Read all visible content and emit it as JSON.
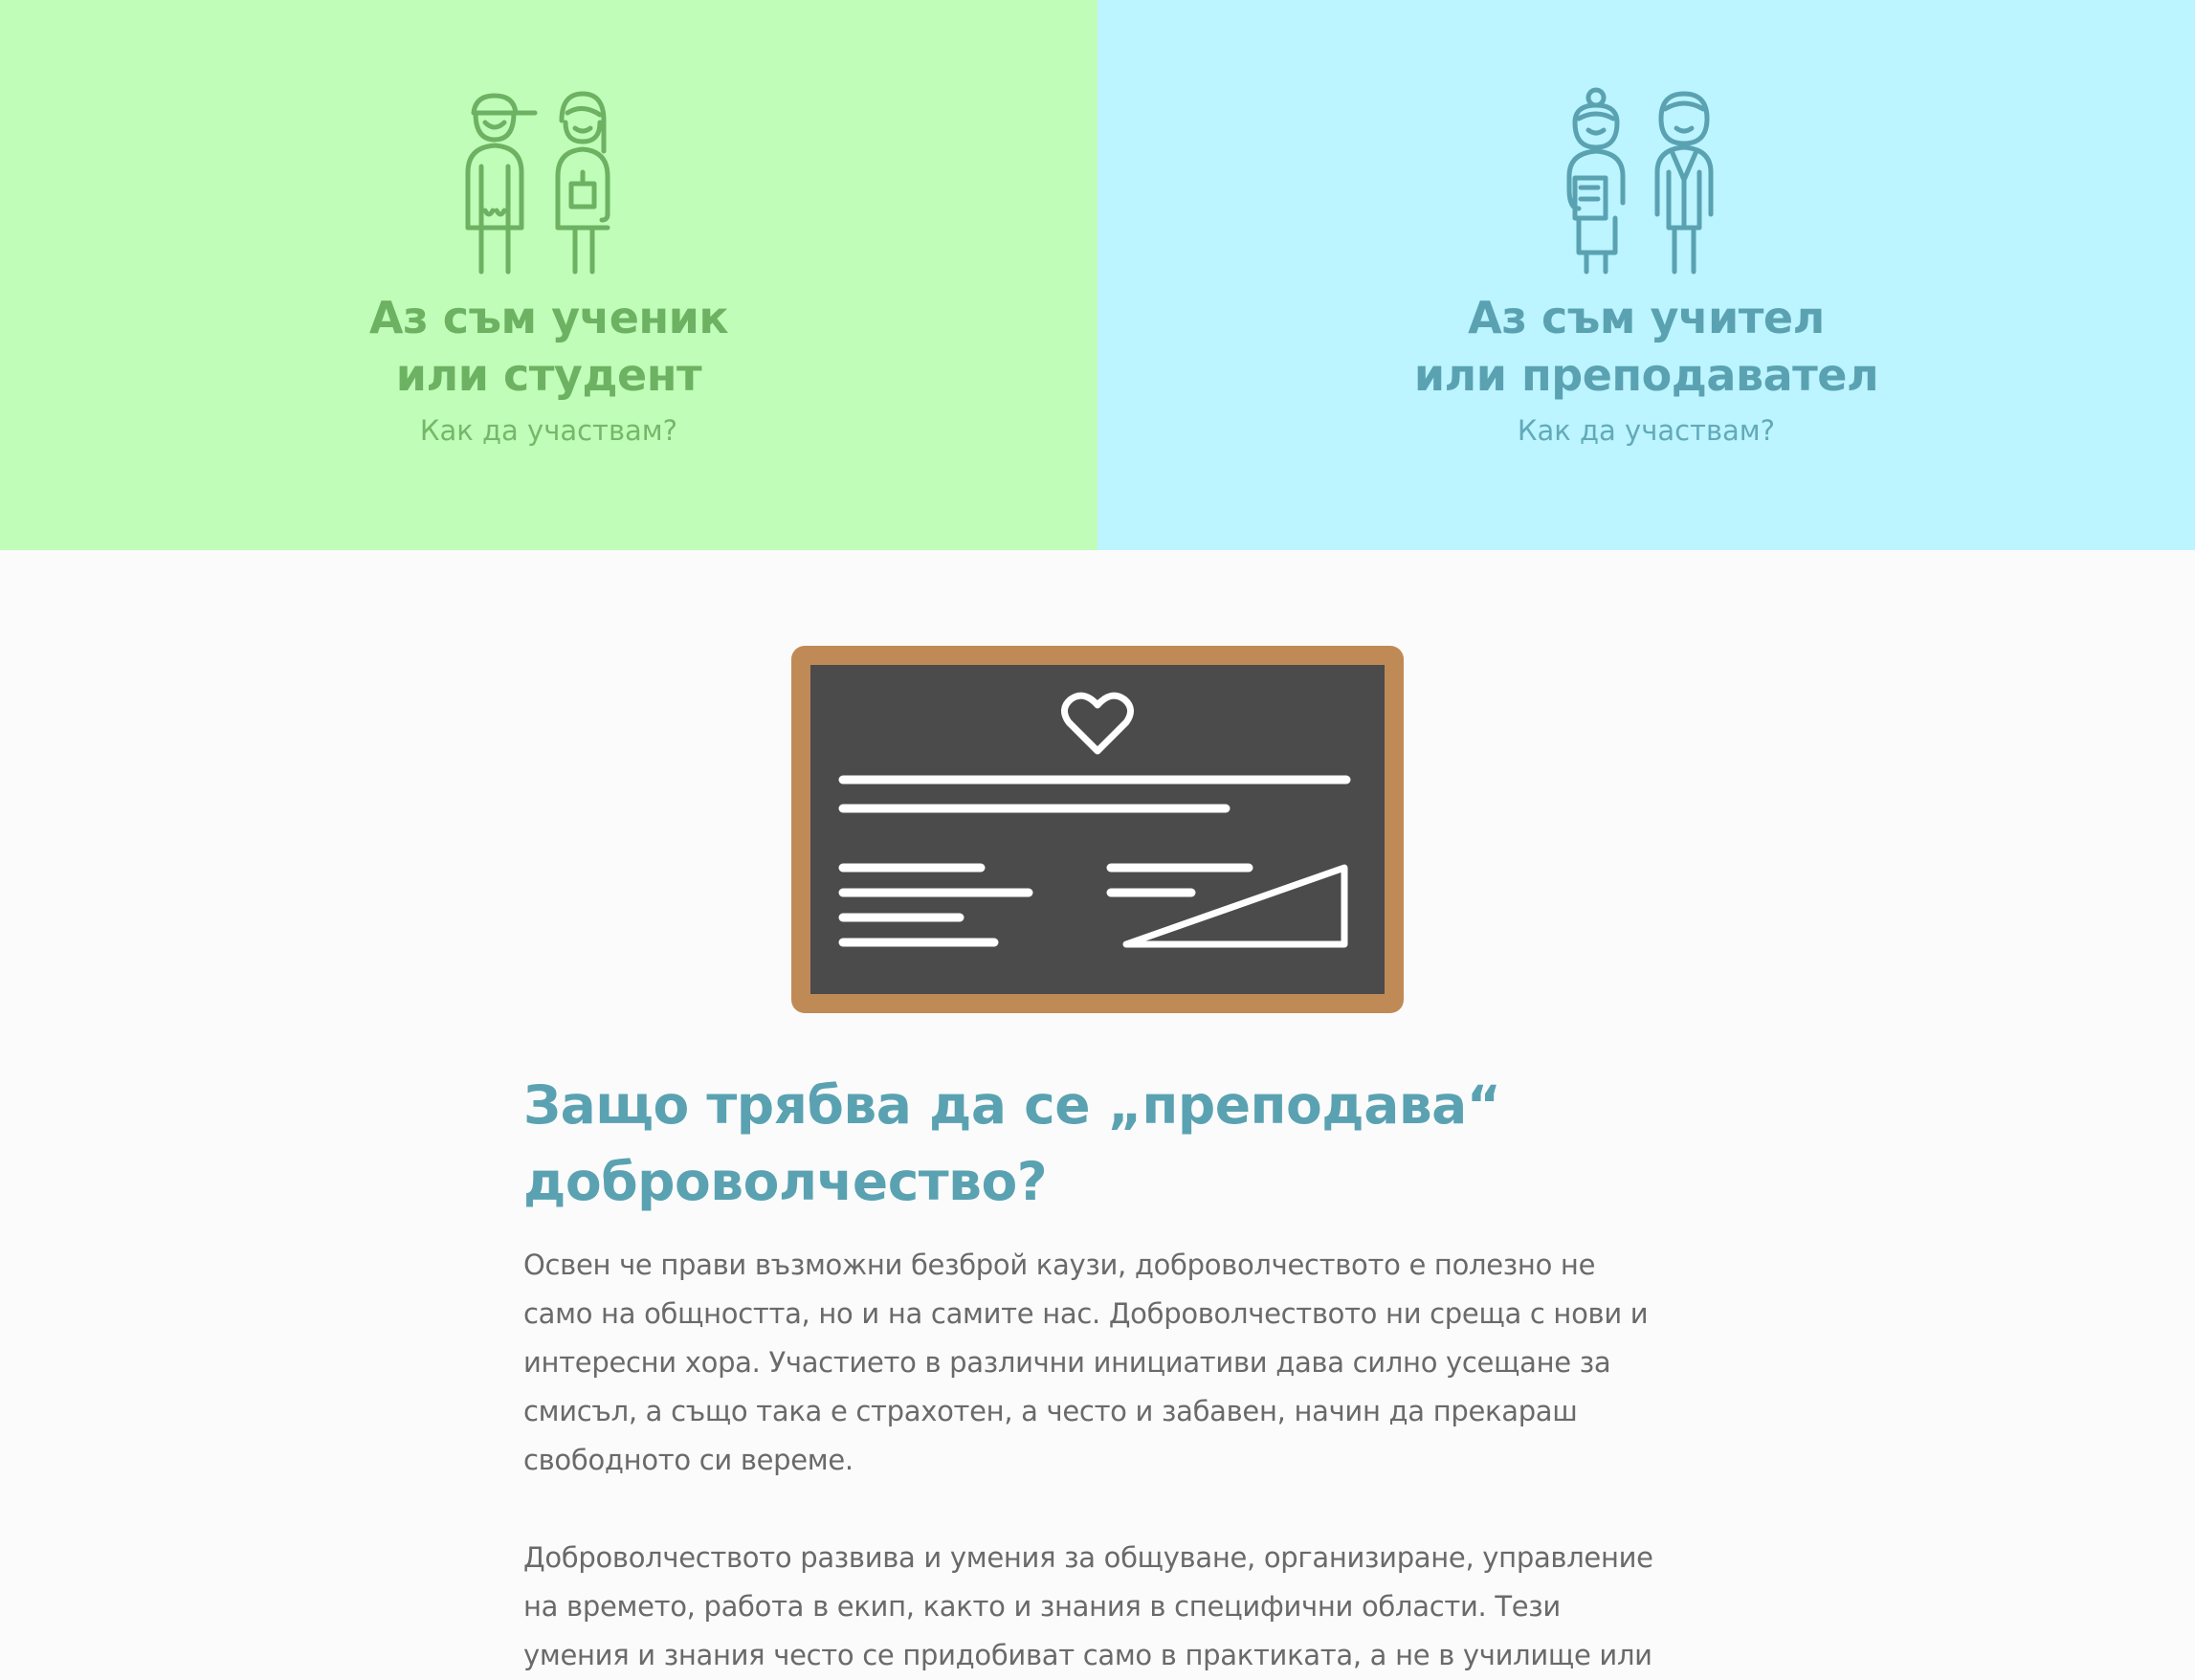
{
  "hero": {
    "students": {
      "title_line1": "Аз съм ученик",
      "title_line2": "или студент",
      "subtitle": "Как да участвам?",
      "icon": "students-icon",
      "color": "#6db162",
      "background": "#c0fdb8"
    },
    "teachers": {
      "title_line1": "Аз съм учител",
      "title_line2": "или преподавател",
      "subtitle": "Как да участвам?",
      "icon": "teachers-icon",
      "color": "#5aa2b1",
      "background": "#bcf4ff"
    }
  },
  "illustration": {
    "icon": "chalkboard-heart-icon",
    "frame_color": "#c08a56",
    "board_color": "#4b4b4b"
  },
  "article": {
    "heading_line1": "Защо трябва да се „преподава“",
    "heading_line2": "доброволчество?",
    "paragraphs": [
      "Освен че прави възможни безброй каузи, доброволчеството е полезно не само на общността, но и на самите нас. Доброволчеството ни среща с нови и интересни хора. Участието в различни инициативи дава силно усещане за смисъл, а също така е страхотен, а често и забавен, начин да прекараш свободното си вереме.",
      "Доброволчеството развива и умения за общуване, организиране, управление на времето, работа в екип, както и знания в специфични области. Тези умения и знания често се придобиват само в практиката, а не в училище или"
    ]
  }
}
